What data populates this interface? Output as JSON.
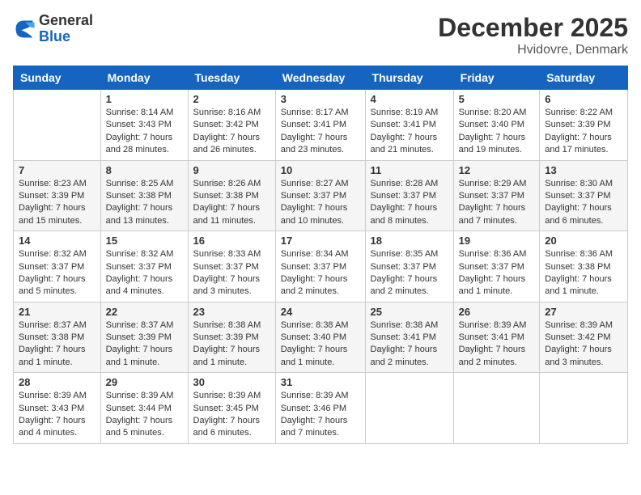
{
  "header": {
    "logo_general": "General",
    "logo_blue": "Blue",
    "month_year": "December 2025",
    "location": "Hvidovre, Denmark"
  },
  "days_of_week": [
    "Sunday",
    "Monday",
    "Tuesday",
    "Wednesday",
    "Thursday",
    "Friday",
    "Saturday"
  ],
  "weeks": [
    [
      {
        "day": "",
        "content": ""
      },
      {
        "day": "1",
        "content": "Sunrise: 8:14 AM\nSunset: 3:43 PM\nDaylight: 7 hours\nand 28 minutes."
      },
      {
        "day": "2",
        "content": "Sunrise: 8:16 AM\nSunset: 3:42 PM\nDaylight: 7 hours\nand 26 minutes."
      },
      {
        "day": "3",
        "content": "Sunrise: 8:17 AM\nSunset: 3:41 PM\nDaylight: 7 hours\nand 23 minutes."
      },
      {
        "day": "4",
        "content": "Sunrise: 8:19 AM\nSunset: 3:41 PM\nDaylight: 7 hours\nand 21 minutes."
      },
      {
        "day": "5",
        "content": "Sunrise: 8:20 AM\nSunset: 3:40 PM\nDaylight: 7 hours\nand 19 minutes."
      },
      {
        "day": "6",
        "content": "Sunrise: 8:22 AM\nSunset: 3:39 PM\nDaylight: 7 hours\nand 17 minutes."
      }
    ],
    [
      {
        "day": "7",
        "content": "Sunrise: 8:23 AM\nSunset: 3:39 PM\nDaylight: 7 hours\nand 15 minutes."
      },
      {
        "day": "8",
        "content": "Sunrise: 8:25 AM\nSunset: 3:38 PM\nDaylight: 7 hours\nand 13 minutes."
      },
      {
        "day": "9",
        "content": "Sunrise: 8:26 AM\nSunset: 3:38 PM\nDaylight: 7 hours\nand 11 minutes."
      },
      {
        "day": "10",
        "content": "Sunrise: 8:27 AM\nSunset: 3:37 PM\nDaylight: 7 hours\nand 10 minutes."
      },
      {
        "day": "11",
        "content": "Sunrise: 8:28 AM\nSunset: 3:37 PM\nDaylight: 7 hours\nand 8 minutes."
      },
      {
        "day": "12",
        "content": "Sunrise: 8:29 AM\nSunset: 3:37 PM\nDaylight: 7 hours\nand 7 minutes."
      },
      {
        "day": "13",
        "content": "Sunrise: 8:30 AM\nSunset: 3:37 PM\nDaylight: 7 hours\nand 6 minutes."
      }
    ],
    [
      {
        "day": "14",
        "content": "Sunrise: 8:32 AM\nSunset: 3:37 PM\nDaylight: 7 hours\nand 5 minutes."
      },
      {
        "day": "15",
        "content": "Sunrise: 8:32 AM\nSunset: 3:37 PM\nDaylight: 7 hours\nand 4 minutes."
      },
      {
        "day": "16",
        "content": "Sunrise: 8:33 AM\nSunset: 3:37 PM\nDaylight: 7 hours\nand 3 minutes."
      },
      {
        "day": "17",
        "content": "Sunrise: 8:34 AM\nSunset: 3:37 PM\nDaylight: 7 hours\nand 2 minutes."
      },
      {
        "day": "18",
        "content": "Sunrise: 8:35 AM\nSunset: 3:37 PM\nDaylight: 7 hours\nand 2 minutes."
      },
      {
        "day": "19",
        "content": "Sunrise: 8:36 AM\nSunset: 3:37 PM\nDaylight: 7 hours\nand 1 minute."
      },
      {
        "day": "20",
        "content": "Sunrise: 8:36 AM\nSunset: 3:38 PM\nDaylight: 7 hours\nand 1 minute."
      }
    ],
    [
      {
        "day": "21",
        "content": "Sunrise: 8:37 AM\nSunset: 3:38 PM\nDaylight: 7 hours\nand 1 minute."
      },
      {
        "day": "22",
        "content": "Sunrise: 8:37 AM\nSunset: 3:39 PM\nDaylight: 7 hours\nand 1 minute."
      },
      {
        "day": "23",
        "content": "Sunrise: 8:38 AM\nSunset: 3:39 PM\nDaylight: 7 hours\nand 1 minute."
      },
      {
        "day": "24",
        "content": "Sunrise: 8:38 AM\nSunset: 3:40 PM\nDaylight: 7 hours\nand 1 minute."
      },
      {
        "day": "25",
        "content": "Sunrise: 8:38 AM\nSunset: 3:41 PM\nDaylight: 7 hours\nand 2 minutes."
      },
      {
        "day": "26",
        "content": "Sunrise: 8:39 AM\nSunset: 3:41 PM\nDaylight: 7 hours\nand 2 minutes."
      },
      {
        "day": "27",
        "content": "Sunrise: 8:39 AM\nSunset: 3:42 PM\nDaylight: 7 hours\nand 3 minutes."
      }
    ],
    [
      {
        "day": "28",
        "content": "Sunrise: 8:39 AM\nSunset: 3:43 PM\nDaylight: 7 hours\nand 4 minutes."
      },
      {
        "day": "29",
        "content": "Sunrise: 8:39 AM\nSunset: 3:44 PM\nDaylight: 7 hours\nand 5 minutes."
      },
      {
        "day": "30",
        "content": "Sunrise: 8:39 AM\nSunset: 3:45 PM\nDaylight: 7 hours\nand 6 minutes."
      },
      {
        "day": "31",
        "content": "Sunrise: 8:39 AM\nSunset: 3:46 PM\nDaylight: 7 hours\nand 7 minutes."
      },
      {
        "day": "",
        "content": ""
      },
      {
        "day": "",
        "content": ""
      },
      {
        "day": "",
        "content": ""
      }
    ]
  ]
}
